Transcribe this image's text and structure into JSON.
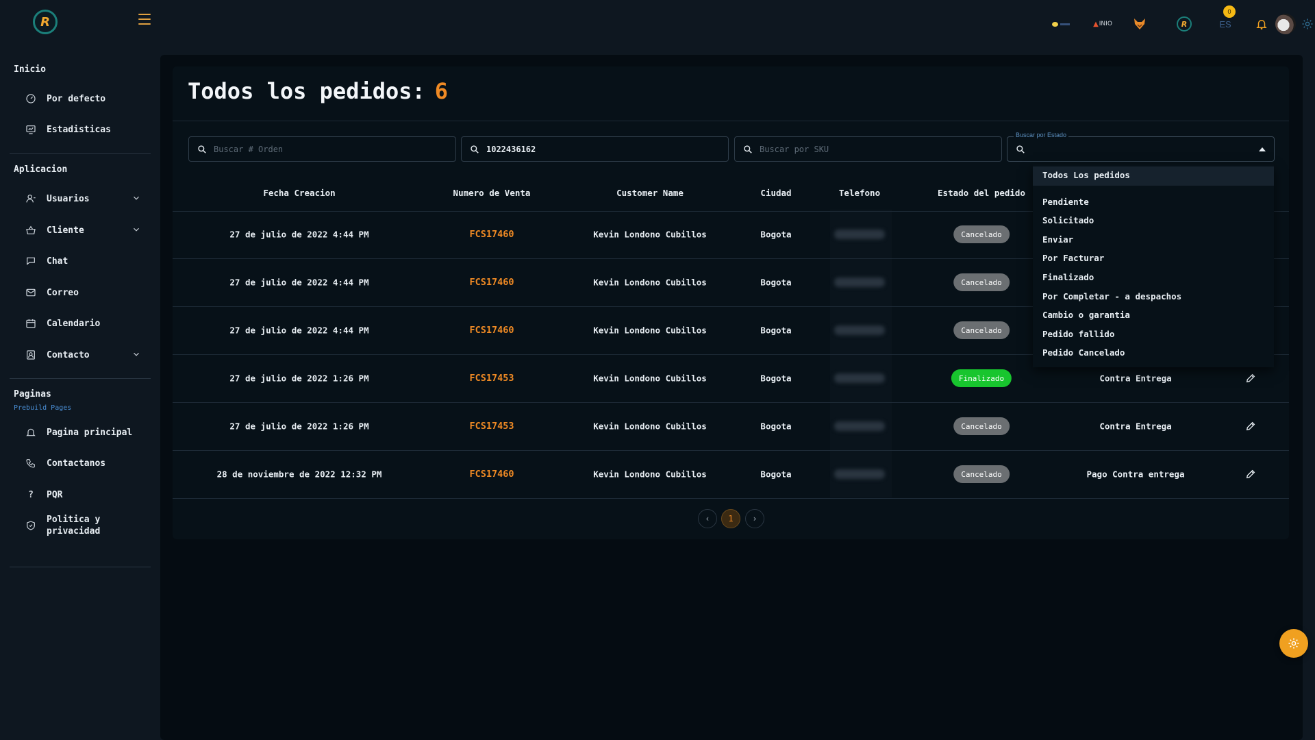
{
  "topbar": {
    "logo_letter": "R",
    "brand_text": "INIO",
    "language": "ES",
    "notification_count": "0"
  },
  "sidebar": {
    "sections": [
      {
        "title": "Inicio"
      },
      {
        "title": "Aplicacion"
      },
      {
        "title": "Paginas",
        "subtitle": "Prebuild Pages"
      }
    ],
    "items": [
      {
        "label": "Por defecto",
        "icon": "gauge-icon"
      },
      {
        "label": "Estadisticas",
        "icon": "monitor-chart-icon"
      },
      {
        "label": "Usuarios",
        "icon": "user-icon",
        "expandable": true
      },
      {
        "label": "Cliente",
        "icon": "basket-icon",
        "expandable": true
      },
      {
        "label": "Chat",
        "icon": "chat-icon"
      },
      {
        "label": "Correo",
        "icon": "mail-icon"
      },
      {
        "label": "Calendario",
        "icon": "calendar-icon"
      },
      {
        "label": "Contacto",
        "icon": "address-book-icon",
        "expandable": true
      },
      {
        "label": "Pagina principal",
        "icon": "bell-icon"
      },
      {
        "label": "Contactanos",
        "icon": "phone-icon"
      },
      {
        "label": "PQR",
        "icon": "question-icon"
      },
      {
        "label": "Politica y privacidad",
        "icon": "shield-icon"
      }
    ]
  },
  "page": {
    "title": "Todos los pedidos:",
    "count": "6"
  },
  "filters": {
    "orden_placeholder": "Buscar # Orden",
    "phone_value": "1022436162",
    "sku_placeholder": "Buscar por SKU",
    "estado_legend": "Buscar por Estado",
    "estado_value": ""
  },
  "table": {
    "headers": [
      "Fecha Creacion",
      "Numero de Venta",
      "Customer Name",
      "Ciudad",
      "Telefono",
      "Estado del pedido"
    ],
    "rows": [
      {
        "fecha": "27 de julio de 2022 4:44 PM",
        "venta": "FCS17460",
        "cliente": "Kevin Londono Cubillos",
        "ciudad": "Bogota",
        "estado": "Cancelado",
        "pago": ""
      },
      {
        "fecha": "27 de julio de 2022 4:44 PM",
        "venta": "FCS17460",
        "cliente": "Kevin Londono Cubillos",
        "ciudad": "Bogota",
        "estado": "Cancelado",
        "pago": ""
      },
      {
        "fecha": "27 de julio de 2022 4:44 PM",
        "venta": "FCS17460",
        "cliente": "Kevin Londono Cubillos",
        "ciudad": "Bogota",
        "estado": "Cancelado",
        "pago": ""
      },
      {
        "fecha": "27 de julio de 2022 1:26 PM",
        "venta": "FCS17453",
        "cliente": "Kevin Londono Cubillos",
        "ciudad": "Bogota",
        "estado": "Finalizado",
        "pago": "Contra Entrega"
      },
      {
        "fecha": "27 de julio de 2022 1:26 PM",
        "venta": "FCS17453",
        "cliente": "Kevin Londono Cubillos",
        "ciudad": "Bogota",
        "estado": "Cancelado",
        "pago": "Contra Entrega"
      },
      {
        "fecha": "28 de noviembre de 2022 12:32 PM",
        "venta": "FCS17460",
        "cliente": "Kevin Londono Cubillos",
        "ciudad": "Bogota",
        "estado": "Cancelado",
        "pago": "Pago Contra entrega"
      }
    ]
  },
  "estado_dropdown": {
    "options": [
      "Todos Los pedidos",
      "Pendiente",
      "Solicitado",
      "Enviar",
      "Por Facturar",
      "Finalizado",
      "Por Completar - a despachos",
      "Cambio o garantia",
      "Pedido fallido",
      "Pedido Cancelado"
    ],
    "selected": "Todos Los pedidos"
  },
  "pagination": {
    "current_page": "1",
    "prev": "‹",
    "next": "›"
  },
  "colors": {
    "accent": "#ef8a24",
    "finalizado": "#18c52e",
    "cancelado": "#6b6f72",
    "background": "#0e1720"
  }
}
